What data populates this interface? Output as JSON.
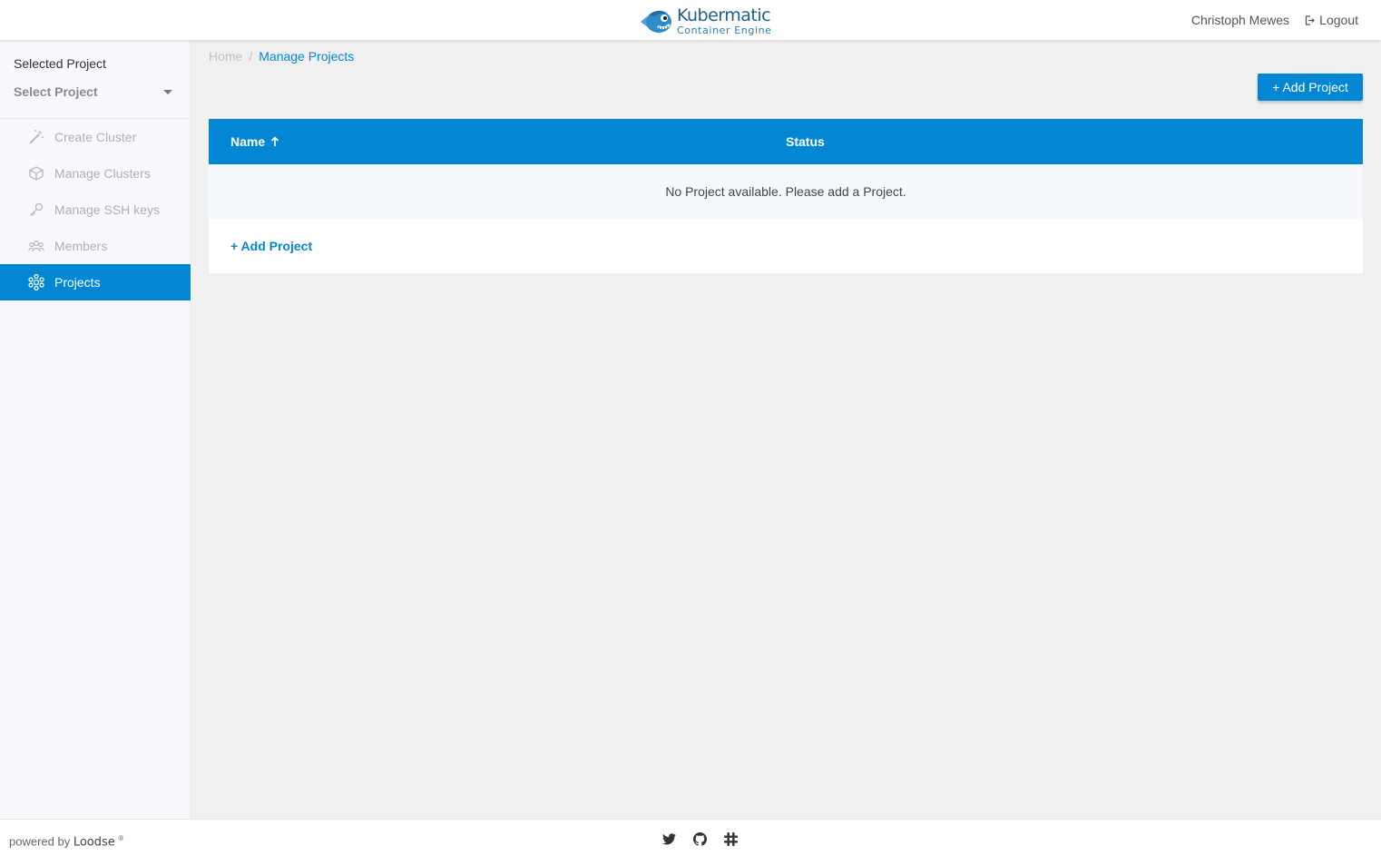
{
  "header": {
    "logo_title": "Kubermatic",
    "logo_subtitle": "Container Engine",
    "user_name": "Christoph Mewes",
    "logout_label": "Logout"
  },
  "sidebar": {
    "selected_project_label": "Selected Project",
    "select_placeholder": "Select Project",
    "items": [
      {
        "label": "Create Cluster",
        "icon": "magic-wand-icon"
      },
      {
        "label": "Manage Clusters",
        "icon": "cube-cluster-icon"
      },
      {
        "label": "Manage SSH keys",
        "icon": "key-icon"
      },
      {
        "label": "Members",
        "icon": "members-icon"
      },
      {
        "label": "Projects",
        "icon": "projects-icon",
        "active": true
      }
    ]
  },
  "breadcrumb": {
    "home": "Home",
    "separator": "/",
    "current": "Manage Projects"
  },
  "toolbar": {
    "add_project_label": "+ Add Project"
  },
  "table": {
    "columns": [
      "Name",
      "Status"
    ],
    "sort_column": "Name",
    "sort_direction": "ascending",
    "empty_message": "No Project available. Please add a Project.",
    "add_link_label": "+ Add Project"
  },
  "footer": {
    "powered_by": "powered by",
    "brand": "Loodse",
    "registered": "®",
    "icons": [
      "twitter-icon",
      "github-icon",
      "slack-icon"
    ]
  },
  "colors": {
    "primary": "#0387d3",
    "sidebar_bg": "#f7f9fc",
    "page_bg": "#f0f0f0"
  }
}
